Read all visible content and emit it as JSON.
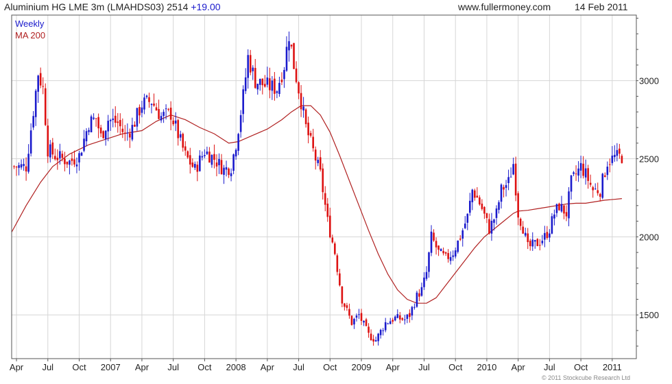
{
  "header": {
    "title": "Aluminium HG LME 3m (LMAHDS03) 2514",
    "change": "+19.00",
    "site": "www.fullermoney.com",
    "date": "14 Feb 2011"
  },
  "footer": {
    "copyright": "© 2011 Stockcube Research Ltd"
  },
  "chart_data": {
    "type": "candlestick",
    "legend": [
      "Weekly",
      "MA 200"
    ],
    "legend_placement": "top-left",
    "grid": true,
    "colors": {
      "up": "#1a1acc",
      "down": "#dd1111",
      "ma": "#b02020",
      "grid": "#d6d6d6"
    },
    "ylim": [
      1220,
      3420
    ],
    "y_ticks": [
      1500,
      2000,
      2500,
      3000
    ],
    "x_ticks": [
      "Apr",
      "Jul",
      "Oct",
      "2007",
      "Apr",
      "Jul",
      "Oct",
      "2008",
      "Apr",
      "Jul",
      "Oct",
      "2009",
      "Apr",
      "Jul",
      "Oct",
      "2010",
      "Apr",
      "Jul",
      "Oct",
      "2011"
    ],
    "x_tick_weeks": [
      0,
      13,
      26,
      39,
      52,
      65,
      78,
      91,
      104,
      117,
      130,
      143,
      156,
      169,
      182,
      195,
      208,
      221,
      234,
      247
    ],
    "x_range_weeks": [
      -2,
      257
    ],
    "anchors": [
      [
        -2,
        2450
      ],
      [
        4,
        2450
      ],
      [
        9,
        3050
      ],
      [
        11,
        2950
      ],
      [
        13,
        2560
      ],
      [
        16,
        2520
      ],
      [
        22,
        2480
      ],
      [
        26,
        2520
      ],
      [
        30,
        2730
      ],
      [
        33,
        2760
      ],
      [
        35,
        2640
      ],
      [
        38,
        2750
      ],
      [
        42,
        2730
      ],
      [
        45,
        2650
      ],
      [
        48,
        2700
      ],
      [
        52,
        2850
      ],
      [
        56,
        2870
      ],
      [
        60,
        2770
      ],
      [
        64,
        2790
      ],
      [
        66,
        2700
      ],
      [
        70,
        2520
      ],
      [
        74,
        2430
      ],
      [
        78,
        2550
      ],
      [
        82,
        2500
      ],
      [
        86,
        2430
      ],
      [
        89,
        2450
      ],
      [
        91,
        2600
      ],
      [
        94,
        2900
      ],
      [
        96,
        3150
      ],
      [
        99,
        3000
      ],
      [
        103,
        2970
      ],
      [
        108,
        2950
      ],
      [
        111,
        3100
      ],
      [
        113,
        3300
      ],
      [
        115,
        3100
      ],
      [
        118,
        2870
      ],
      [
        120,
        2700
      ],
      [
        123,
        2550
      ],
      [
        126,
        2400
      ],
      [
        129,
        2100
      ],
      [
        132,
        1900
      ],
      [
        135,
        1600
      ],
      [
        139,
        1450
      ],
      [
        142,
        1500
      ],
      [
        146,
        1370
      ],
      [
        149,
        1340
      ],
      [
        153,
        1450
      ],
      [
        157,
        1480
      ],
      [
        161,
        1470
      ],
      [
        163,
        1500
      ],
      [
        166,
        1620
      ],
      [
        168,
        1660
      ],
      [
        170,
        1770
      ],
      [
        172,
        2000
      ],
      [
        175,
        1900
      ],
      [
        178,
        1860
      ],
      [
        181,
        1900
      ],
      [
        184,
        2000
      ],
      [
        187,
        2130
      ],
      [
        189,
        2300
      ],
      [
        191,
        2250
      ],
      [
        193,
        2180
      ],
      [
        196,
        2050
      ],
      [
        199,
        2150
      ],
      [
        201,
        2300
      ],
      [
        204,
        2350
      ],
      [
        206,
        2470
      ],
      [
        208,
        2150
      ],
      [
        210,
        2060
      ],
      [
        212,
        1930
      ],
      [
        216,
        1960
      ],
      [
        219,
        2000
      ],
      [
        221,
        2050
      ],
      [
        223,
        2150
      ],
      [
        225,
        2200
      ],
      [
        228,
        2150
      ],
      [
        230,
        2350
      ],
      [
        232,
        2400
      ],
      [
        234,
        2450
      ],
      [
        236,
        2400
      ],
      [
        239,
        2300
      ],
      [
        242,
        2300
      ],
      [
        245,
        2480
      ],
      [
        248,
        2510
      ],
      [
        251,
        2514
      ]
    ],
    "ma200_anchors": [
      [
        -2,
        2030
      ],
      [
        4,
        2200
      ],
      [
        10,
        2350
      ],
      [
        15,
        2450
      ],
      [
        22,
        2530
      ],
      [
        30,
        2590
      ],
      [
        38,
        2630
      ],
      [
        44,
        2660
      ],
      [
        52,
        2680
      ],
      [
        58,
        2740
      ],
      [
        64,
        2780
      ],
      [
        70,
        2750
      ],
      [
        76,
        2700
      ],
      [
        82,
        2660
      ],
      [
        88,
        2600
      ],
      [
        92,
        2610
      ],
      [
        98,
        2650
      ],
      [
        104,
        2690
      ],
      [
        110,
        2750
      ],
      [
        114,
        2800
      ],
      [
        118,
        2840
      ],
      [
        122,
        2840
      ],
      [
        126,
        2780
      ],
      [
        130,
        2670
      ],
      [
        134,
        2520
      ],
      [
        138,
        2360
      ],
      [
        142,
        2200
      ],
      [
        146,
        2040
      ],
      [
        150,
        1890
      ],
      [
        154,
        1760
      ],
      [
        158,
        1660
      ],
      [
        162,
        1600
      ],
      [
        166,
        1575
      ],
      [
        170,
        1575
      ],
      [
        174,
        1610
      ],
      [
        178,
        1690
      ],
      [
        182,
        1770
      ],
      [
        186,
        1850
      ],
      [
        190,
        1930
      ],
      [
        194,
        2000
      ],
      [
        198,
        2050
      ],
      [
        202,
        2100
      ],
      [
        206,
        2150
      ],
      [
        208,
        2165
      ],
      [
        212,
        2170
      ],
      [
        216,
        2180
      ],
      [
        220,
        2190
      ],
      [
        224,
        2200
      ],
      [
        228,
        2210
      ],
      [
        232,
        2215
      ],
      [
        236,
        2215
      ],
      [
        240,
        2225
      ],
      [
        244,
        2235
      ],
      [
        248,
        2240
      ],
      [
        251,
        2245
      ]
    ]
  }
}
